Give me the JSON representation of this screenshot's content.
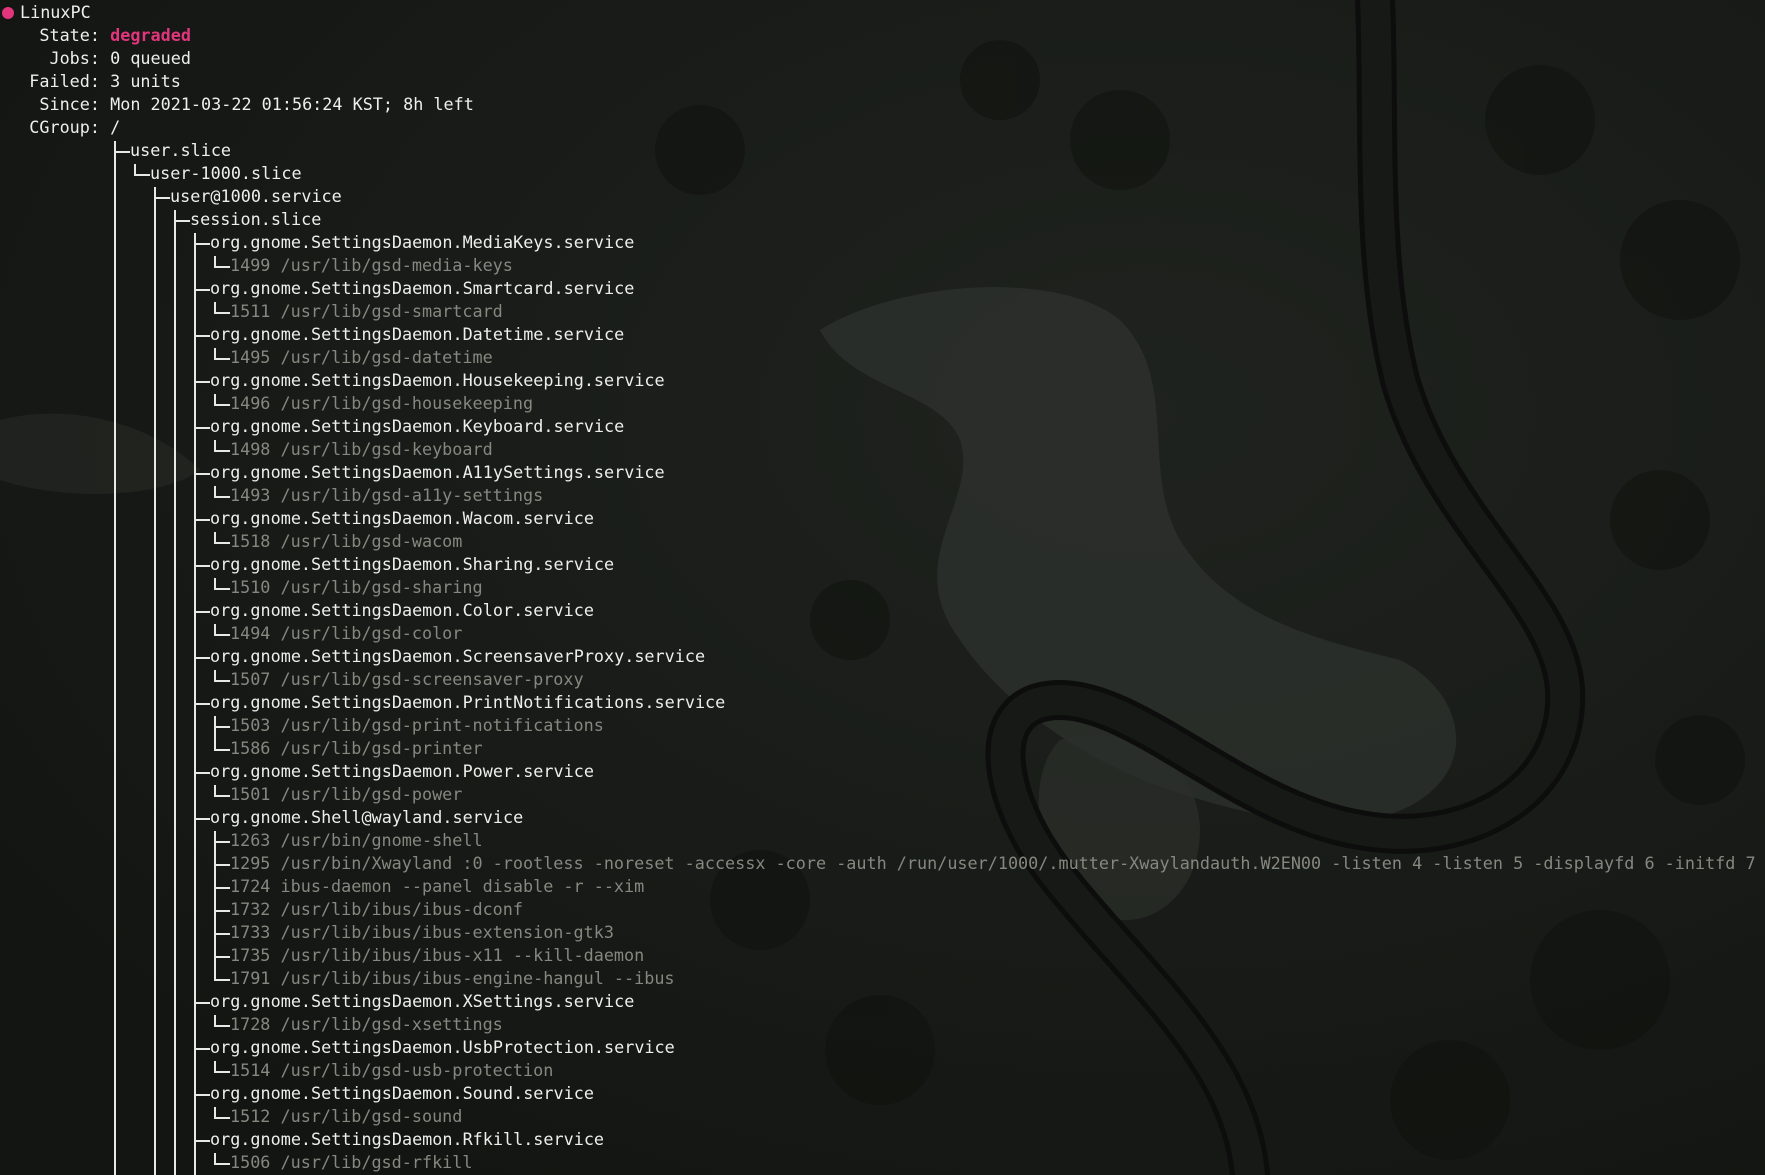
{
  "theme": {
    "text": "#eeeeea",
    "dim_text": "#86877f",
    "accent": "#e2357c",
    "background": "#1e211d"
  },
  "header": {
    "dot_icon": "red-circle",
    "hostname": "LinuxPC",
    "fields": [
      {
        "label": "State:",
        "value": "degraded"
      },
      {
        "label": "Jobs:",
        "value": "0 queued"
      },
      {
        "label": "Failed:",
        "value": "3 units"
      },
      {
        "label": "Since:",
        "value": "Mon 2021-03-22 01:56:24 KST; 8h left"
      },
      {
        "label": "CGroup:",
        "value": "/"
      }
    ]
  },
  "tree": {
    "user_slice": "user.slice",
    "user_1000_slice": "user-1000.slice",
    "user_service": "user@1000.service",
    "session_slice": "session.slice",
    "services": [
      {
        "name": "org.gnome.SettingsDaemon.MediaKeys.service",
        "procs": [
          "1499 /usr/lib/gsd-media-keys"
        ]
      },
      {
        "name": "org.gnome.SettingsDaemon.Smartcard.service",
        "procs": [
          "1511 /usr/lib/gsd-smartcard"
        ]
      },
      {
        "name": "org.gnome.SettingsDaemon.Datetime.service",
        "procs": [
          "1495 /usr/lib/gsd-datetime"
        ]
      },
      {
        "name": "org.gnome.SettingsDaemon.Housekeeping.service",
        "procs": [
          "1496 /usr/lib/gsd-housekeeping"
        ]
      },
      {
        "name": "org.gnome.SettingsDaemon.Keyboard.service",
        "procs": [
          "1498 /usr/lib/gsd-keyboard"
        ]
      },
      {
        "name": "org.gnome.SettingsDaemon.A11ySettings.service",
        "procs": [
          "1493 /usr/lib/gsd-a11y-settings"
        ]
      },
      {
        "name": "org.gnome.SettingsDaemon.Wacom.service",
        "procs": [
          "1518 /usr/lib/gsd-wacom"
        ]
      },
      {
        "name": "org.gnome.SettingsDaemon.Sharing.service",
        "procs": [
          "1510 /usr/lib/gsd-sharing"
        ]
      },
      {
        "name": "org.gnome.SettingsDaemon.Color.service",
        "procs": [
          "1494 /usr/lib/gsd-color"
        ]
      },
      {
        "name": "org.gnome.SettingsDaemon.ScreensaverProxy.service",
        "procs": [
          "1507 /usr/lib/gsd-screensaver-proxy"
        ]
      },
      {
        "name": "org.gnome.SettingsDaemon.PrintNotifications.service",
        "procs": [
          "1503 /usr/lib/gsd-print-notifications",
          "1586 /usr/lib/gsd-printer"
        ]
      },
      {
        "name": "org.gnome.SettingsDaemon.Power.service",
        "procs": [
          "1501 /usr/lib/gsd-power"
        ]
      },
      {
        "name": "org.gnome.Shell@wayland.service",
        "procs": [
          "1263 /usr/bin/gnome-shell",
          "1295 /usr/bin/Xwayland :0 -rootless -noreset -accessx -core -auth /run/user/1000/.mutter-Xwaylandauth.W2EN00 -listen 4 -listen 5 -displayfd 6 -initfd 7",
          "1724 ibus-daemon --panel disable -r --xim",
          "1732 /usr/lib/ibus/ibus-dconf",
          "1733 /usr/lib/ibus/ibus-extension-gtk3",
          "1735 /usr/lib/ibus/ibus-x11 --kill-daemon",
          "1791 /usr/lib/ibus/ibus-engine-hangul --ibus"
        ]
      },
      {
        "name": "org.gnome.SettingsDaemon.XSettings.service",
        "procs": [
          "1728 /usr/lib/gsd-xsettings"
        ]
      },
      {
        "name": "org.gnome.SettingsDaemon.UsbProtection.service",
        "procs": [
          "1514 /usr/lib/gsd-usb-protection"
        ]
      },
      {
        "name": "org.gnome.SettingsDaemon.Sound.service",
        "procs": [
          "1512 /usr/lib/gsd-sound"
        ]
      },
      {
        "name": "org.gnome.SettingsDaemon.Rfkill.service",
        "procs": [
          "1506 /usr/lib/gsd-rfkill"
        ]
      }
    ]
  }
}
